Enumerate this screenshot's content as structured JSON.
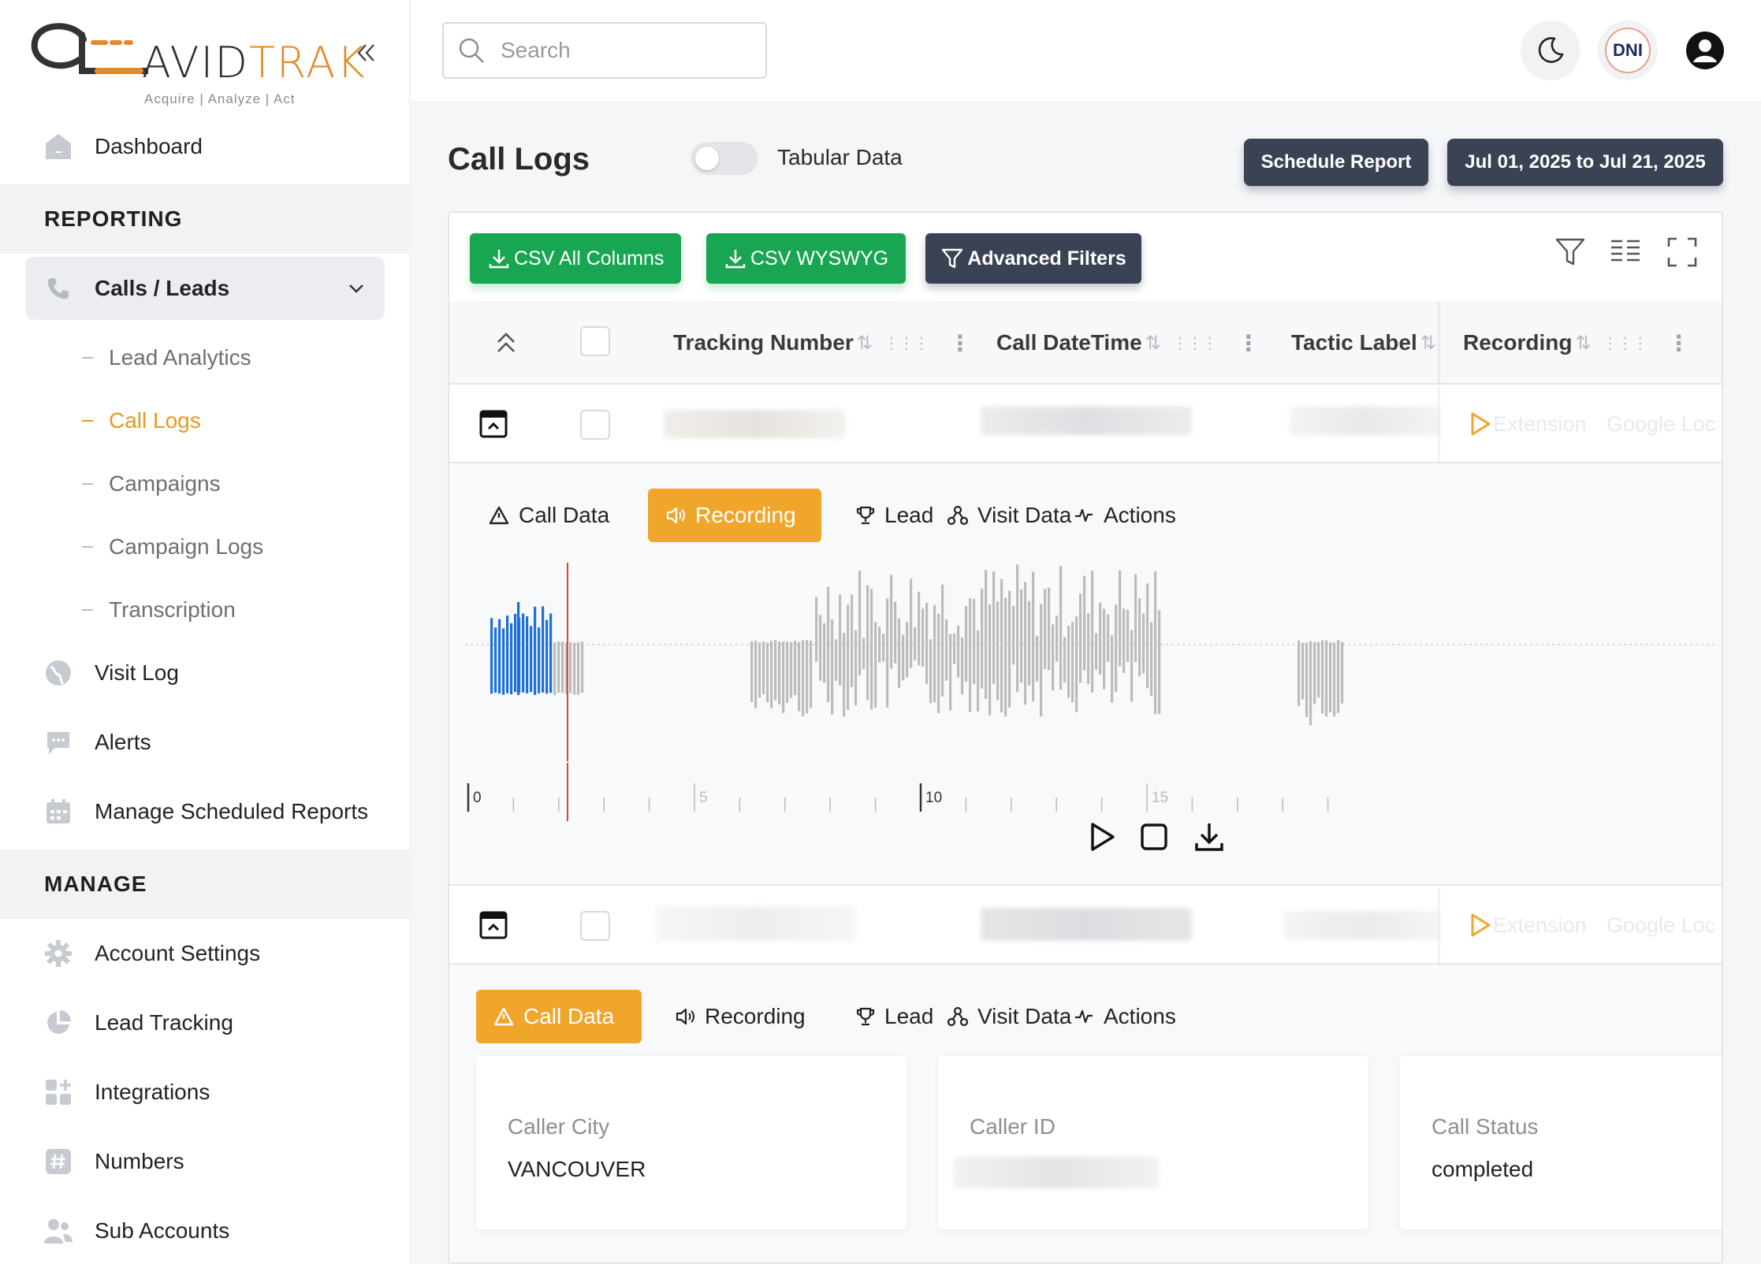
{
  "brand": {
    "name_dark": "AVID",
    "name_accent": "TRAK",
    "tagline": "Acquire   |   Analyze   |   Act",
    "accent_color": "#e48a24"
  },
  "sidebar": {
    "dashboard": "Dashboard",
    "section_reporting": "REPORTING",
    "calls_leads": "Calls / Leads",
    "sub_items": [
      "Lead Analytics",
      "Call Logs",
      "Campaigns",
      "Campaign Logs",
      "Transcription"
    ],
    "visit_log": "Visit Log",
    "alerts": "Alerts",
    "manage_scheduled_reports": "Manage Scheduled Reports",
    "section_manage": "MANAGE",
    "manage_items": [
      "Account Settings",
      "Lead Tracking",
      "Integrations",
      "Numbers",
      "Sub Accounts"
    ]
  },
  "topbar": {
    "search_placeholder": "Search",
    "dni_label": "DNI"
  },
  "page": {
    "title": "Call Logs",
    "toggle_label": "Tabular Data",
    "schedule_report": "Schedule Report",
    "date_range": "Jul 01, 2025 to Jul 21, 2025"
  },
  "toolbar": {
    "csv_all": "CSV All Columns",
    "csv_wysiwyg": "CSV WYSWYG",
    "advanced_filters": "Advanced Filters"
  },
  "table": {
    "columns": [
      "Tracking Number",
      "Call DateTime",
      "Tactic Label",
      "Recording"
    ],
    "faded_cells": [
      "Extension",
      "Google Loc"
    ]
  },
  "detail_tabs": [
    "Call Data",
    "Recording",
    "Lead",
    "Visit Data",
    "Actions"
  ],
  "recording": {
    "ruler_labels": [
      "0",
      "5",
      "10",
      "15"
    ],
    "played_color": "#1e6fd9",
    "unplayed_color": "#bcbcbc",
    "cursor_color": "#e0452b"
  },
  "call_data": {
    "cards": [
      {
        "label": "Caller City",
        "value": "VANCOUVER"
      },
      {
        "label": "Caller ID",
        "value": ""
      },
      {
        "label": "Call Status",
        "value": "completed"
      }
    ]
  },
  "colors": {
    "orange": "#f0a62b",
    "green": "#19a653",
    "dark": "#3a4253"
  }
}
